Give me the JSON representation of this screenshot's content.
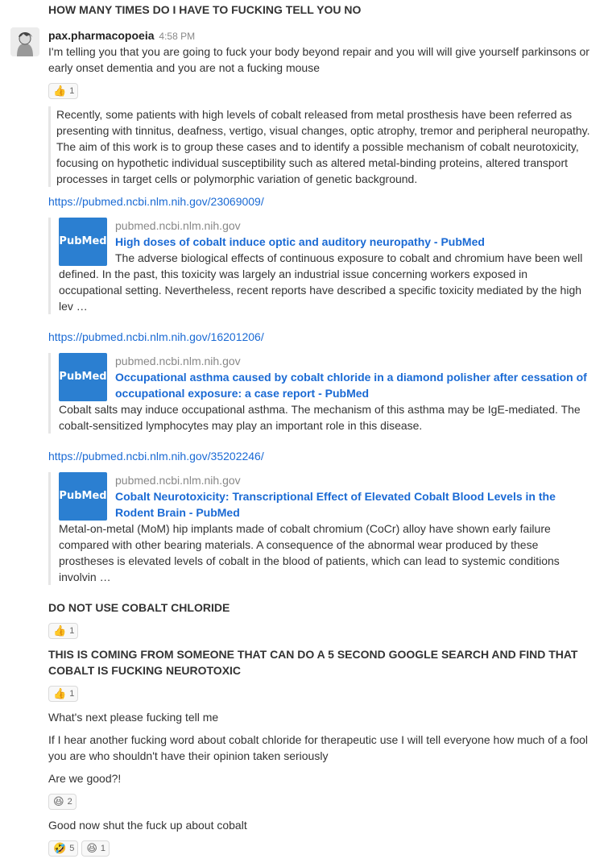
{
  "messages": {
    "m0": "HOW MANY TIMES DO I HAVE TO FUCKING TELL YOU NO",
    "author": "pax.pharmacopoeia",
    "time": "4:58 PM",
    "m1": "I'm telling you that you are going to fuck your body beyond repair and you will will give yourself parkinsons or early onset dementia and you are not a fucking mouse",
    "quote": " Recently, some patients with high levels of cobalt released from metal prosthesis have been referred as presenting with tinnitus, deafness, vertigo, visual changes, optic atrophy, tremor and peripheral neuropathy. The aim of this work is to group these cases and to identify a possible mechanism of cobalt neurotoxicity, focusing on hypothetic individual susceptibility such as altered metal-binding proteins, altered transport processes in target cells or polymorphic variation of genetic background.",
    "link1": "https://pubmed.ncbi.nlm.nih.gov/23069009/",
    "link2": "https://pubmed.ncbi.nlm.nih.gov/16201206/",
    "link3": "https://pubmed.ncbi.nlm.nih.gov/35202246/",
    "m_donot": "DO NOT USE COBALT CHLORIDE",
    "m_coming": "THIS IS COMING FROM SOMEONE THAT CAN DO A 5 SECOND GOOGLE SEARCH AND FIND THAT COBALT IS FUCKING NEUROTOXIC",
    "m_whatsnext": "What's next please fucking tell me",
    "m_ifhear": "If I hear another fucking word about cobalt chloride for therapeutic use I will tell everyone how much of a fool you are who shouldn't have their opinion taken seriously",
    "m_good": "Are we good?!",
    "m_shut": "Good now shut the fuck up about cobalt"
  },
  "embeds": [
    {
      "site": "pubmed.ncbi.nlm.nih.gov",
      "thumb": "PubMed",
      "title": "High doses of cobalt induce optic and auditory neuropathy - PubMed",
      "desc": "The adverse biological effects of continuous exposure to cobalt and chromium have been well defined. In the past, this toxicity was largely an industrial issue concerning workers exposed in occupational setting. Nevertheless, recent reports have described a specific toxicity mediated by the high lev …"
    },
    {
      "site": "pubmed.ncbi.nlm.nih.gov",
      "thumb": "PubMed",
      "title": "Occupational asthma caused by cobalt chloride in a diamond polisher after cessation of occupational exposure: a case report - PubMed",
      "desc": "Cobalt salts may induce occupational asthma. The mechanism of this asthma may be IgE-mediated. The cobalt-sensitized lymphocytes may play an important role in this disease."
    },
    {
      "site": "pubmed.ncbi.nlm.nih.gov",
      "thumb": "PubMed",
      "title": "Cobalt Neurotoxicity: Transcriptional Effect of Elevated Cobalt Blood Levels in the Rodent Brain - PubMed",
      "desc": "Metal-on-metal (MoM) hip implants made of cobalt chromium (CoCr) alloy have shown early failure compared with other bearing materials. A consequence of the abnormal wear produced by these prostheses is elevated levels of cobalt in the blood of patients, which can lead to systemic conditions involvin …"
    }
  ],
  "reactions": {
    "r1": {
      "emoji": "👍",
      "count": "1"
    },
    "r2": {
      "emoji": "👍",
      "count": "1"
    },
    "r3": {
      "emoji": "👍",
      "count": "1"
    },
    "r4": {
      "emoji": "😆",
      "count": "2"
    },
    "r5a": {
      "emoji": "🤣",
      "count": "5"
    },
    "r5b": {
      "emoji": "😆",
      "count": "1"
    }
  },
  "colors": {
    "link": "#1a6ad4",
    "border": "#e6e6e6"
  }
}
